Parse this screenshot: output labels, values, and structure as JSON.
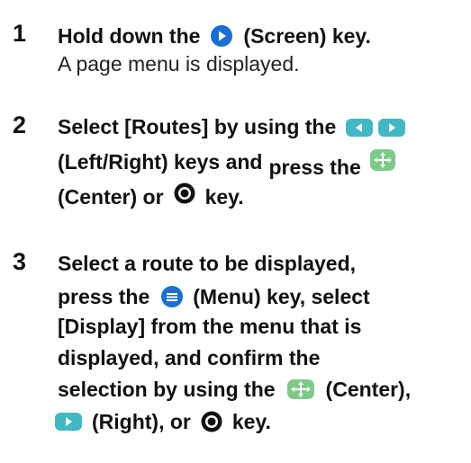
{
  "steps": [
    {
      "number": "1",
      "line1_pre": "Hold down the",
      "line1_post": "(Screen) key.",
      "line2": "A page menu is displayed.",
      "icons": [
        "screen-key-icon"
      ]
    },
    {
      "number": "2",
      "line1_pre": "Select [Routes] by using the",
      "line2_pre": "(Left/Right) keys and",
      "line2_mid": "press the",
      "line3_pre": "(Center) or",
      "line3_post": "key.",
      "icons": [
        "left-key-icon",
        "right-key-icon",
        "center-key-icon",
        "enter-key-icon"
      ]
    },
    {
      "number": "3",
      "line1": "Select a route to be displayed,",
      "line2_pre": "press the",
      "line2_post": "(Menu) key, select",
      "line3": "[Display] from the menu that is",
      "line4": "displayed, and confirm the",
      "line5_pre": "selection by using the",
      "line5_post": "(Center),",
      "line6_mid": "(Right), or",
      "line6_post": "key.",
      "icons": [
        "menu-key-icon",
        "center-key-icon",
        "right-key-icon",
        "enter-key-icon"
      ]
    }
  ],
  "colors": {
    "blue_key": "#1a6fd1",
    "cyan_key": "#43b7c4",
    "green_key": "#7fc98a",
    "black_key": "#111111"
  }
}
